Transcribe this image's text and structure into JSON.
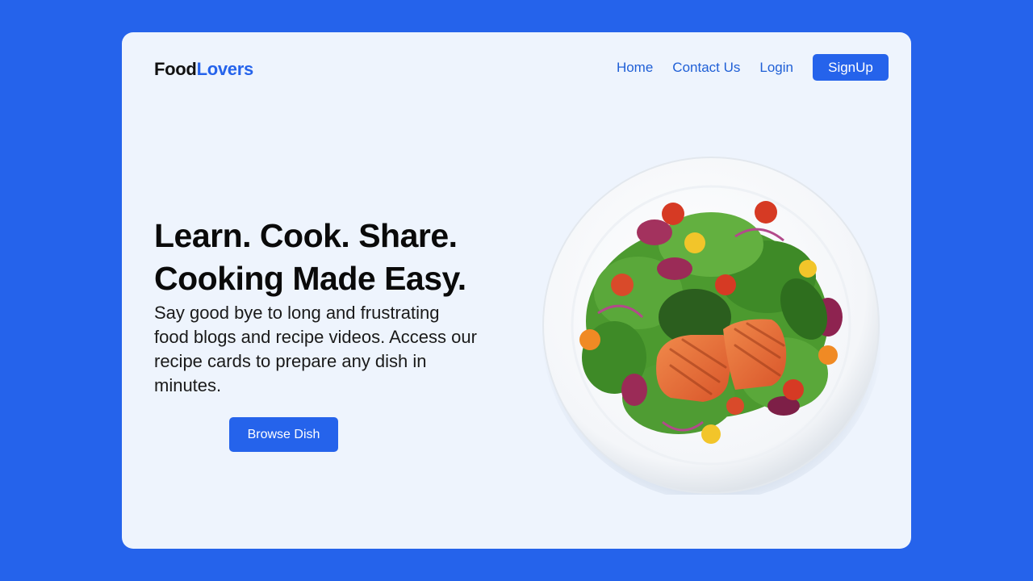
{
  "brand": {
    "part1": "Food",
    "part2": "Lovers"
  },
  "nav": {
    "items": [
      {
        "label": "Home"
      },
      {
        "label": "Contact Us"
      },
      {
        "label": "Login"
      }
    ],
    "signup_label": "SignUp"
  },
  "hero": {
    "headline_line1": "Learn. Cook. Share.",
    "headline_line2": "Cooking Made Easy.",
    "description": "Say good bye to long and frustrating food blogs and recipe videos. Access our recipe cards to prepare any dish in minutes.",
    "cta_label": "Browse Dish"
  },
  "colors": {
    "page_background": "#2563eb",
    "card_background": "#eef4fd",
    "accent": "#2563eb",
    "heading": "#0a0a0a"
  },
  "icons": {
    "hero_image": "salmon-salad-plate-image"
  }
}
